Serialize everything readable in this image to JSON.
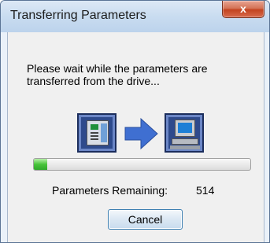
{
  "window": {
    "title": "Transferring Parameters",
    "close_label": "x"
  },
  "message": "Please wait while the parameters are transferred from the drive...",
  "icons": {
    "source": "drive-icon",
    "direction": "right-arrow-icon",
    "destination": "computer-icon"
  },
  "progress": {
    "percent": 6,
    "fill_color": "#3cba30"
  },
  "status": {
    "label": "Parameters Remaining:",
    "value": "514"
  },
  "buttons": {
    "cancel_label": "Cancel"
  },
  "colors": {
    "close_button": "#c3431f",
    "arrow": "#3f6fd1",
    "icon_frame": "#2e4a8c"
  }
}
